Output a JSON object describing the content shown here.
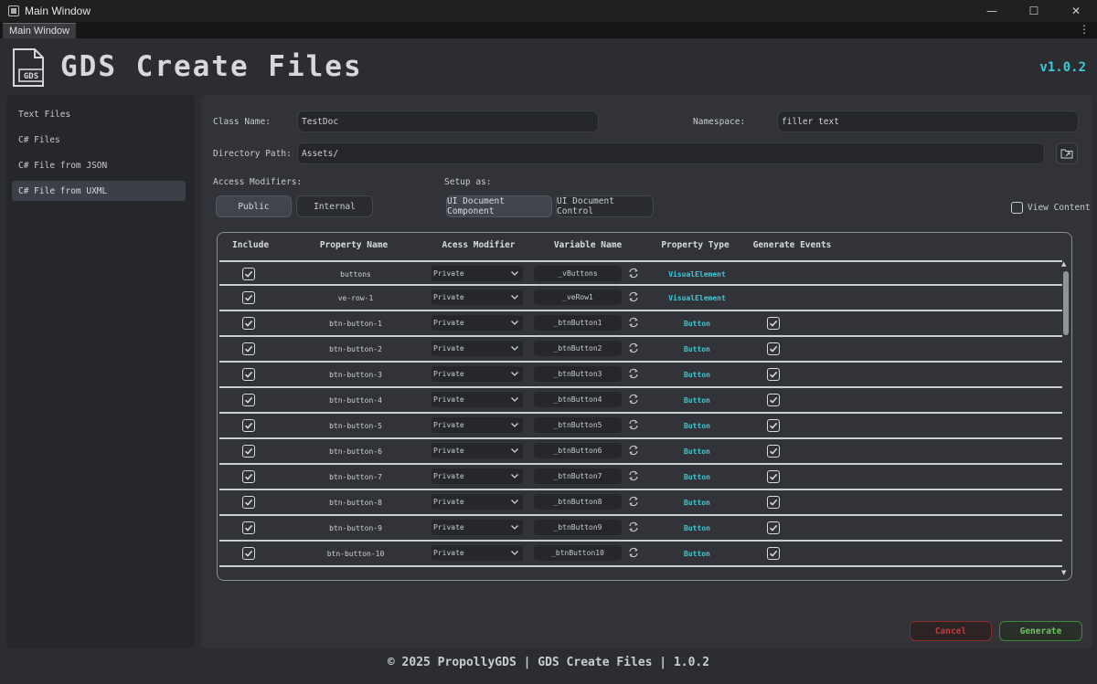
{
  "os": {
    "title": "Main Window",
    "minimize": "—",
    "maximize": "☐",
    "close": "✕"
  },
  "tab": {
    "label": "Main Window",
    "menu": "⋮"
  },
  "header": {
    "logo_text": "GDS",
    "title": "GDS Create Files",
    "version": "v1.0.2"
  },
  "sidebar": {
    "items": [
      {
        "label": "Text Files"
      },
      {
        "label": "C# Files"
      },
      {
        "label": "C# File from JSON"
      },
      {
        "label": "C# File from UXML"
      }
    ],
    "active_index": 3
  },
  "form": {
    "class_name_label": "Class Name:",
    "class_name_value": "TestDoc",
    "namespace_label": "Namespace:",
    "namespace_value": "filler text",
    "directory_label": "Directory Path:",
    "directory_value": "Assets/",
    "access_label": "Access Modifiers:",
    "access_options": [
      "Public",
      "Internal"
    ],
    "access_selected": "Public",
    "setup_label": "Setup as:",
    "setup_options": [
      "UI Document Component",
      "UI Document Control"
    ],
    "setup_selected": "UI Document Component",
    "view_content_label": "View Content",
    "view_content_checked": false
  },
  "table": {
    "columns": [
      "Include",
      "Property Name",
      "Acess Modifier",
      "Variable Name",
      "Property Type",
      "Generate Events"
    ],
    "rows": [
      {
        "include": true,
        "name": "buttons",
        "modifier": "Private",
        "variable": "_vButtons",
        "type": "VisualElement",
        "events": false
      },
      {
        "include": true,
        "name": "ve-row-1",
        "modifier": "Private",
        "variable": "_veRow1",
        "type": "VisualElement",
        "events": false
      },
      {
        "include": true,
        "name": "btn-button-1",
        "modifier": "Private",
        "variable": "_btnButton1",
        "type": "Button",
        "events": true
      },
      {
        "include": true,
        "name": "btn-button-2",
        "modifier": "Private",
        "variable": "_btnButton2",
        "type": "Button",
        "events": true
      },
      {
        "include": true,
        "name": "btn-button-3",
        "modifier": "Private",
        "variable": "_btnButton3",
        "type": "Button",
        "events": true
      },
      {
        "include": true,
        "name": "btn-button-4",
        "modifier": "Private",
        "variable": "_btnButton4",
        "type": "Button",
        "events": true
      },
      {
        "include": true,
        "name": "btn-button-5",
        "modifier": "Private",
        "variable": "_btnButton5",
        "type": "Button",
        "events": true
      },
      {
        "include": true,
        "name": "btn-button-6",
        "modifier": "Private",
        "variable": "_btnButton6",
        "type": "Button",
        "events": true
      },
      {
        "include": true,
        "name": "btn-button-7",
        "modifier": "Private",
        "variable": "_btnButton7",
        "type": "Button",
        "events": true
      },
      {
        "include": true,
        "name": "btn-button-8",
        "modifier": "Private",
        "variable": "_btnButton8",
        "type": "Button",
        "events": true
      },
      {
        "include": true,
        "name": "btn-button-9",
        "modifier": "Private",
        "variable": "_btnButton9",
        "type": "Button",
        "events": true
      },
      {
        "include": true,
        "name": "btn-button-10",
        "modifier": "Private",
        "variable": "_btnButton10",
        "type": "Button",
        "events": true
      }
    ]
  },
  "actions": {
    "cancel": "Cancel",
    "generate": "Generate"
  },
  "footer": {
    "text": "© 2025 PropollyGDS | GDS Create Files | 1.0.2"
  },
  "colors": {
    "accent_cyan": "#3fc9d8",
    "cancel_red": "#c23a3a",
    "generate_green": "#6fbf63"
  },
  "icons": {
    "app": "app-icon",
    "folder": "folder-icon",
    "refresh": "refresh-icon",
    "chevron": "chevron-down-icon",
    "check": "check-icon"
  }
}
